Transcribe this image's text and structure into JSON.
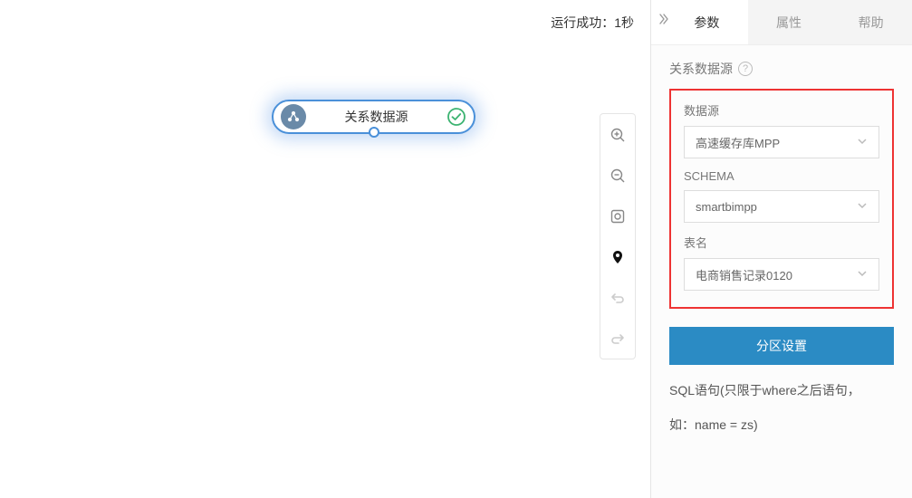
{
  "status": {
    "text": "运行成功：1秒"
  },
  "node": {
    "label": "关系数据源"
  },
  "tabs": {
    "params": "参数",
    "attrs": "属性",
    "help": "帮助"
  },
  "panel": {
    "sectionTitle": "关系数据源",
    "helpMark": "?",
    "fields": {
      "datasourceLabel": "数据源",
      "datasourceValue": "高速缓存库MPP",
      "schemaLabel": "SCHEMA",
      "schemaValue": "smartbimpp",
      "tableLabel": "表名",
      "tableValue": "电商销售记录0120"
    },
    "partitionBtn": "分区设置",
    "sqlLabel": "SQL语句(只限于where之后语句，",
    "sqlHint": "如：name = zs)"
  }
}
